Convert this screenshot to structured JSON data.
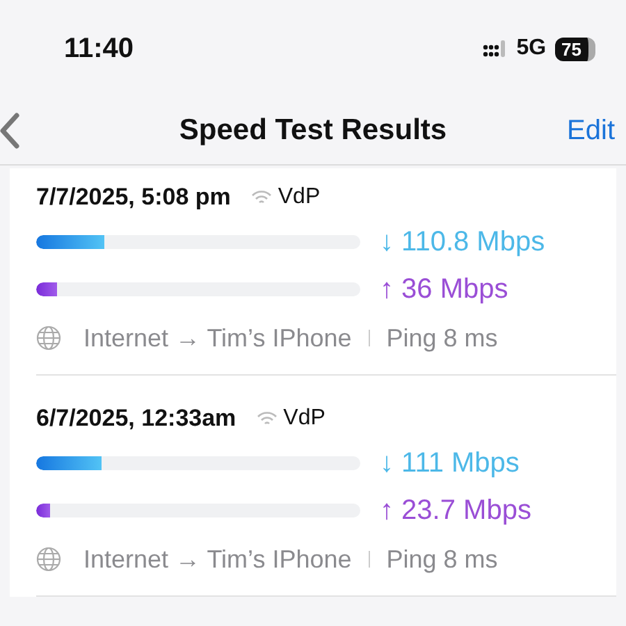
{
  "status_bar": {
    "time": "11:40",
    "network": "5G",
    "battery": "75"
  },
  "nav": {
    "title": "Speed Test Results",
    "action": "Edit"
  },
  "results": [
    {
      "date": "7/7/2025, 5:08 pm",
      "wifi_name": "VdP",
      "download": {
        "level": 0.21,
        "reading": "↓ 110.8 Mbps"
      },
      "upload": {
        "level": 0.065,
        "reading": "↑ 36 Mbps"
      },
      "route": "Internet → Tim’s IPhone",
      "ping": "Ping 8 ms"
    },
    {
      "date": "6/7/2025, 12:33am",
      "wifi_name": "VdP",
      "download": {
        "level": 0.2,
        "reading": "↓ 111 Mbps"
      },
      "upload": {
        "level": 0.045,
        "reading": "↑ 23.7 Mbps"
      },
      "route": "Internet → Tim’s IPhone",
      "ping": "Ping 8 ms"
    }
  ]
}
